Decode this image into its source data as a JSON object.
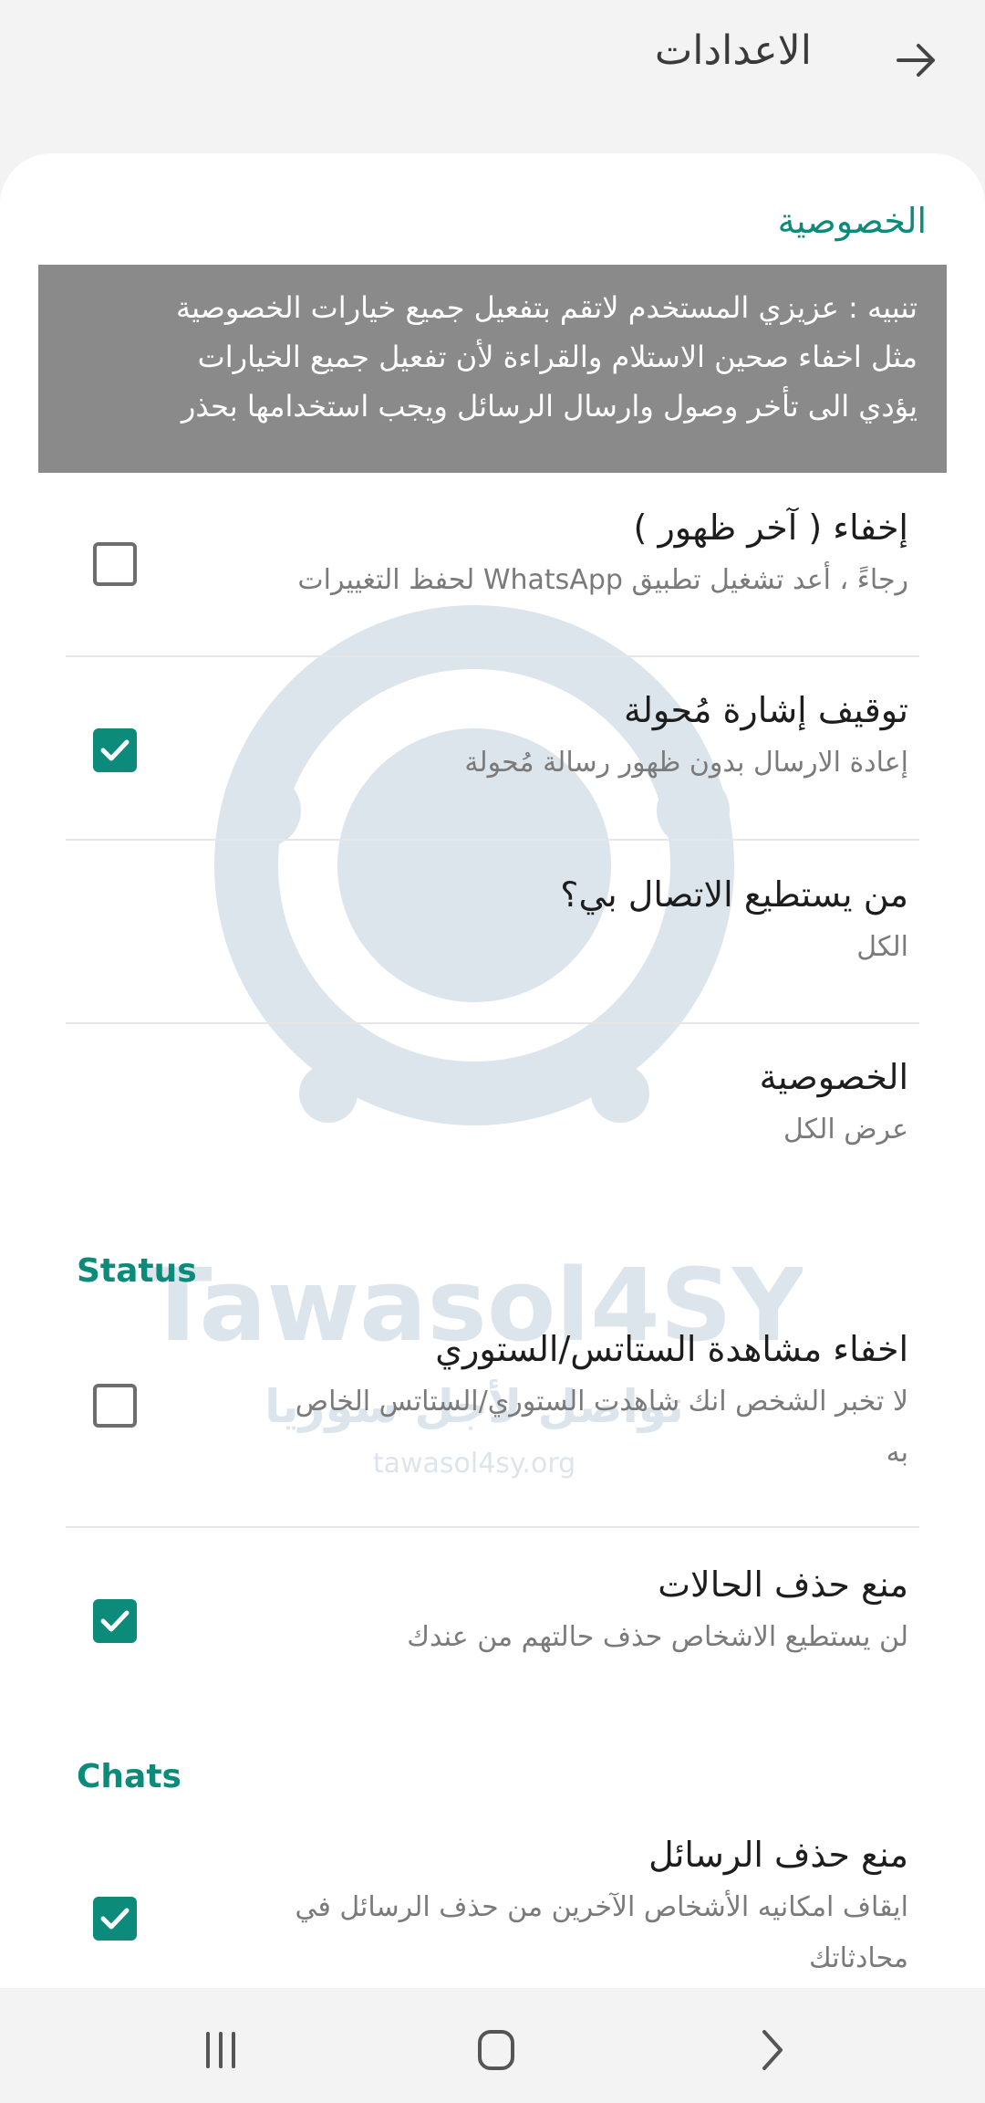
{
  "header": {
    "title": "الاعدادات",
    "back_icon": "arrow-right-icon"
  },
  "privacy_section": {
    "title": "الخصوصية",
    "notice": {
      "line1": "تنبيه : عزيزي المستخدم لاتقم بتفعيل جميع خيارات الخصوصية",
      "line2": "مثل اخفاء صحين الاستلام والقراءة لأن تفعيل جميع الخيارات",
      "line3": "يؤدي الى تأخر وصول وارسال الرسائل ويجب استخدامها بحذر"
    },
    "items": [
      {
        "label": "إخفاء ( آخر ظهور )",
        "sub": "رجاءً ، أعد تشغيل تطبيق WhatsApp لحفظ التغييرات",
        "checked": false
      },
      {
        "label": "توقيف إشارة مُحولة",
        "sub": "إعادة الارسال بدون ظهور رسالة مُحولة",
        "checked": true
      },
      {
        "label": "من يستطيع الاتصال بي؟",
        "sub": "الكل"
      },
      {
        "label": "الخصوصية",
        "sub": "عرض الكل"
      }
    ]
  },
  "status_section": {
    "title": "Status",
    "items": [
      {
        "label": "اخفاء مشاهدة الستاتس/الستوري",
        "sub_line1": "لا تخبر الشخص انك شاهدت الستوري/الستاتس الخاص",
        "sub_line2": "به",
        "checked": false
      },
      {
        "label": "منع حذف الحالات",
        "sub": "لن يستطيع الاشخاص حذف حالتهم من عندك",
        "checked": true
      }
    ]
  },
  "chats_section": {
    "title": "Chats",
    "items": [
      {
        "label": "منع حذف الرسائل",
        "sub_line1": "ايقاف امكانيه الأشخاص الآخرين من حذف الرسائل في",
        "sub_line2": "محادثاتك",
        "checked": true
      }
    ]
  },
  "watermark": {
    "brand": "Tawasol4SY",
    "tagline": "تواصل لأجل سوريا",
    "url": "tawasol4sy.org"
  },
  "navbar": {
    "recents_icon": "recents-icon",
    "home_icon": "home-icon",
    "back_icon": "chevron-back-icon"
  },
  "colors": {
    "accent": "#0c8a7a",
    "notice_bg": "#8a8a8a",
    "background": "#f3f3f3"
  }
}
